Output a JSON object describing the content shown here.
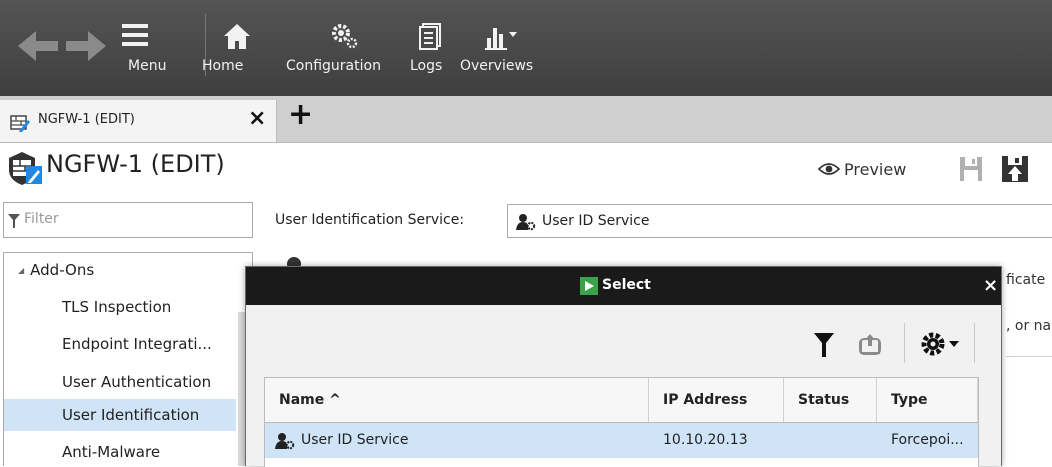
{
  "toolbar": {
    "back": "back-arrow-icon",
    "forward": "forward-arrow-icon",
    "menu_label": "Menu",
    "home_label": "Home",
    "configuration_label": "Configuration",
    "logs_label": "Logs",
    "overviews_label": "Overviews"
  },
  "tabs": [
    {
      "label": "NGFW-1 (EDIT)",
      "close": "×"
    }
  ],
  "tab_add": "+",
  "page": {
    "title": "NGFW-1 (EDIT)",
    "preview_label": "Preview"
  },
  "sidebar": {
    "filter_placeholder": "Filter",
    "group": {
      "expander": "◢",
      "label": "Add-Ons"
    },
    "items": [
      {
        "label": "TLS Inspection",
        "selected": false
      },
      {
        "label": "Endpoint Integrati...",
        "selected": false
      },
      {
        "label": "User Authentication",
        "selected": false
      },
      {
        "label": "User Identification",
        "selected": true
      },
      {
        "label": "Anti-Malware",
        "selected": false
      }
    ]
  },
  "content": {
    "uid_label": "User Identification Service:",
    "uid_value": "User ID Service",
    "frag_1": "ficate",
    "frag_2": ", or na"
  },
  "dialog": {
    "title": "Select",
    "close": "×",
    "columns": [
      {
        "label": "Name ^"
      },
      {
        "label": "IP Address"
      },
      {
        "label": "Status"
      },
      {
        "label": "Type"
      }
    ],
    "rows": [
      {
        "name": "User ID Service",
        "ip": "10.10.20.13",
        "status": "",
        "type": "Forcepoi..."
      }
    ]
  },
  "colors": {
    "toolbar_bg": "#4a4a4a",
    "selection": "#cfe5f7",
    "dialog_title_bg": "#1a1a1a",
    "select_icon_green": "#3aa34a",
    "edit_icon_blue": "#1e88e5"
  }
}
